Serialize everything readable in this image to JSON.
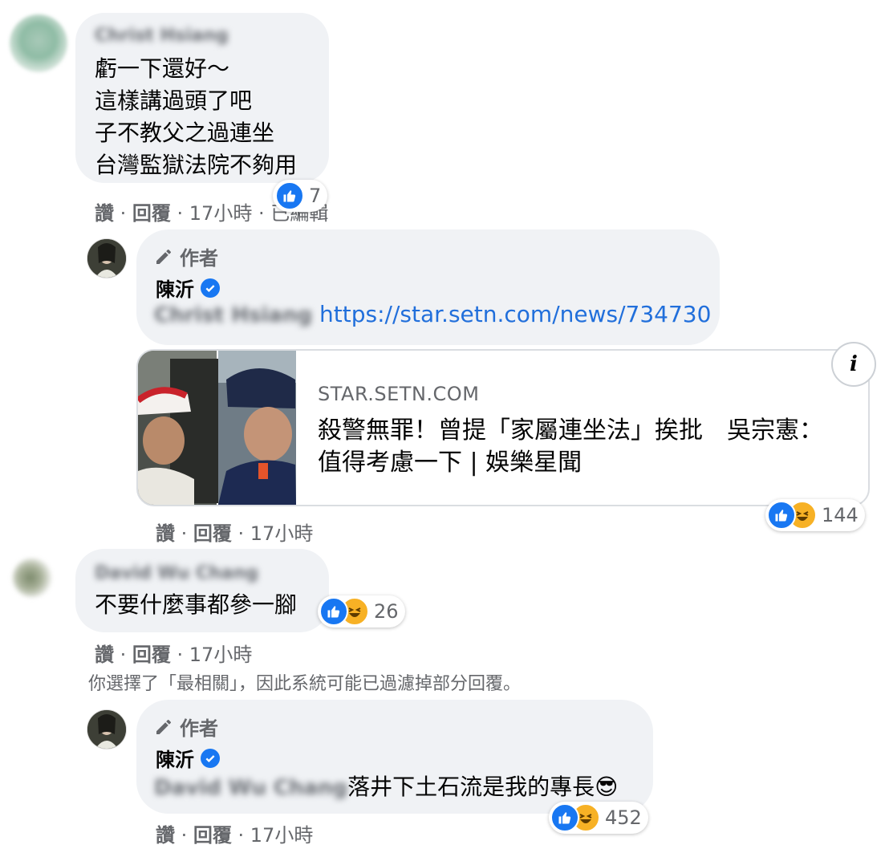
{
  "comments": [
    {
      "name": "Christ Hsiang",
      "lines": [
        "虧一下還好～",
        "這樣講過頭了吧",
        "子不教父之過連坐",
        "台灣監獄法院不夠用"
      ],
      "reaction_count": "7",
      "meta": {
        "like": "讚",
        "reply": "回覆",
        "time": "17小時",
        "edited": "已編輯"
      }
    },
    {
      "author_badge": "作者",
      "name": "陳沂",
      "mention": "Christ Hsiang",
      "link": "https://star.setn.com/news/734730",
      "card": {
        "domain": "STAR.SETN.COM",
        "title": "殺警無罪！曾提「家屬連坐法」挨批　吳宗憲：值得考慮一下 | 娛樂星聞",
        "info": "i"
      },
      "reaction_count": "144",
      "meta": {
        "like": "讚",
        "reply": "回覆",
        "time": "17小時"
      }
    },
    {
      "name": "David Wu Chang",
      "text": "不要什麼事都參一腳",
      "reaction_count": "26",
      "meta": {
        "like": "讚",
        "reply": "回覆",
        "time": "17小時"
      }
    },
    {
      "author_badge": "作者",
      "name": "陳沂",
      "mention": "David Wu Chang",
      "text": "落井下土石流是我的專長",
      "emoji": "😎",
      "reaction_count": "452",
      "meta": {
        "like": "讚",
        "reply": "回覆",
        "time": "17小時"
      }
    }
  ],
  "filter_notice": "你選擇了「最相關」，因此系統可能已過濾掉部分回覆。",
  "separator": " · ",
  "colors": {
    "bubble": "#f0f2f5",
    "link": "#216fdb",
    "like": "#1877f2",
    "haha": "#f7b125",
    "meta": "#65676b"
  },
  "icons": [
    "like-icon",
    "haha-icon",
    "pencil-icon",
    "verified-icon",
    "info-icon"
  ]
}
